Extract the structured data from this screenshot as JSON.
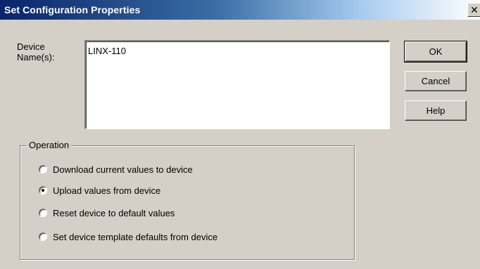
{
  "dialog": {
    "title": "Set Configuration Properties",
    "close_glyph": "✕"
  },
  "device_names": {
    "label_line1": "Device",
    "label_line2": "Name(s):",
    "value": "LINX-110"
  },
  "buttons": {
    "ok": "OK",
    "cancel": "Cancel",
    "help": "Help"
  },
  "operation": {
    "legend": "Operation",
    "options": [
      {
        "label": "Download current values to device",
        "selected": false
      },
      {
        "label": "Upload values from device",
        "selected": true
      },
      {
        "label": "Reset device to default values",
        "selected": false
      },
      {
        "label": "Set device template defaults from device",
        "selected": false
      }
    ]
  }
}
